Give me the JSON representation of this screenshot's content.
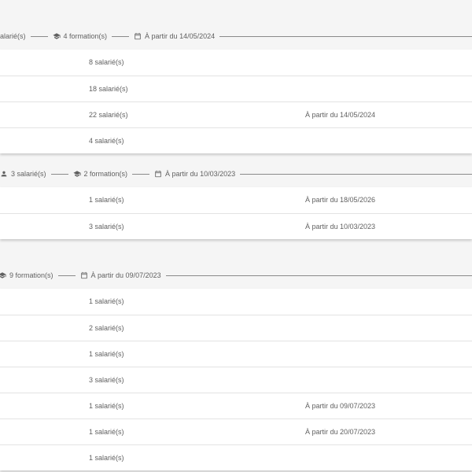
{
  "groups": [
    {
      "header": {
        "salaries": "alarié(s)",
        "formations": "4 formation(s)",
        "date": "À partir du 14/05/2024"
      },
      "rows": [
        {
          "count": "8 salarié(s)",
          "date": ""
        },
        {
          "count": "18 salarié(s)",
          "date": ""
        },
        {
          "count": "22 salarié(s)",
          "date": "À partir du 14/05/2024"
        },
        {
          "count": "4 salarié(s)",
          "date": ""
        }
      ]
    },
    {
      "header": {
        "salaries": "3 salarié(s)",
        "formations": "2 formation(s)",
        "date": "À partir du 10/03/2023"
      },
      "rows": [
        {
          "count": "1 salarié(s)",
          "date": "À partir du 18/05/2026"
        },
        {
          "count": "3 salarié(s)",
          "date": "À partir du 10/03/2023"
        }
      ]
    },
    {
      "header": {
        "formations": "9 formation(s)",
        "date": "À partir du 09/07/2023"
      },
      "rows": [
        {
          "count": "1 salarié(s)",
          "date": ""
        },
        {
          "count": "2 salarié(s)",
          "date": ""
        },
        {
          "count": "1 salarié(s)",
          "date": ""
        },
        {
          "count": "3 salarié(s)",
          "date": ""
        },
        {
          "count": "1 salarié(s)",
          "date": "À partir du 09/07/2023"
        },
        {
          "count": "1 salarié(s)",
          "date": "À partir du 20/07/2023"
        },
        {
          "count": "1 salarié(s)",
          "date": ""
        }
      ]
    }
  ],
  "icons": {
    "salaries": "person-icon",
    "formations": "graduation-cap-icon",
    "date": "calendar-icon"
  },
  "colors": {
    "background": "#f5f5f5",
    "card": "#ffffff",
    "text": "#616161",
    "divider": "#e3e3e3"
  }
}
